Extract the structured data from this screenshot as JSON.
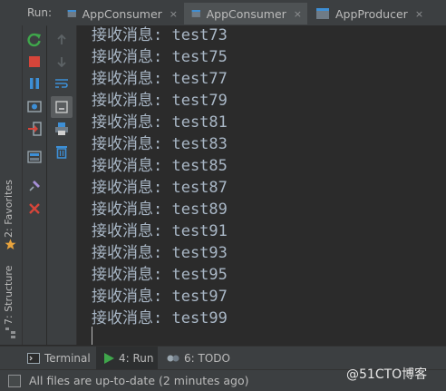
{
  "run_panel": {
    "label": "Run:",
    "tabs": [
      {
        "label": "AppConsumer",
        "active": false
      },
      {
        "label": "AppConsumer",
        "active": true
      },
      {
        "label": "AppProducer",
        "active": false
      }
    ],
    "close_glyph": "×"
  },
  "left_stripe": {
    "favorites_label": "2: Favorites",
    "structure_label": "7: Structure"
  },
  "console": {
    "lines": [
      "接收消息: test73",
      "接收消息: test75",
      "接收消息: test77",
      "接收消息: test79",
      "接收消息: test81",
      "接收消息: test83",
      "接收消息: test85",
      "接收消息: test87",
      "接收消息: test89",
      "接收消息: test91",
      "接收消息: test93",
      "接收消息: test95",
      "接收消息: test97",
      "接收消息: test99"
    ]
  },
  "bottom_tabs": [
    {
      "label": "Terminal",
      "icon": "terminal-icon",
      "active": false
    },
    {
      "label": "4: Run",
      "icon": "run-icon",
      "active": true
    },
    {
      "label": "6: TODO",
      "icon": "todo-icon",
      "active": false
    }
  ],
  "status_bar": {
    "message": "All files are up-to-date (2 minutes ago)"
  },
  "watermark": "@51CTO博客",
  "colors": {
    "background": "#2b2b2b",
    "panel": "#3c3f41",
    "console_text": "#a9b7c6",
    "rerun_green": "#3fa64b",
    "stop_red": "#d6453a",
    "pause_blue": "#3d8fd6",
    "favorite_star": "#e8a33d"
  }
}
